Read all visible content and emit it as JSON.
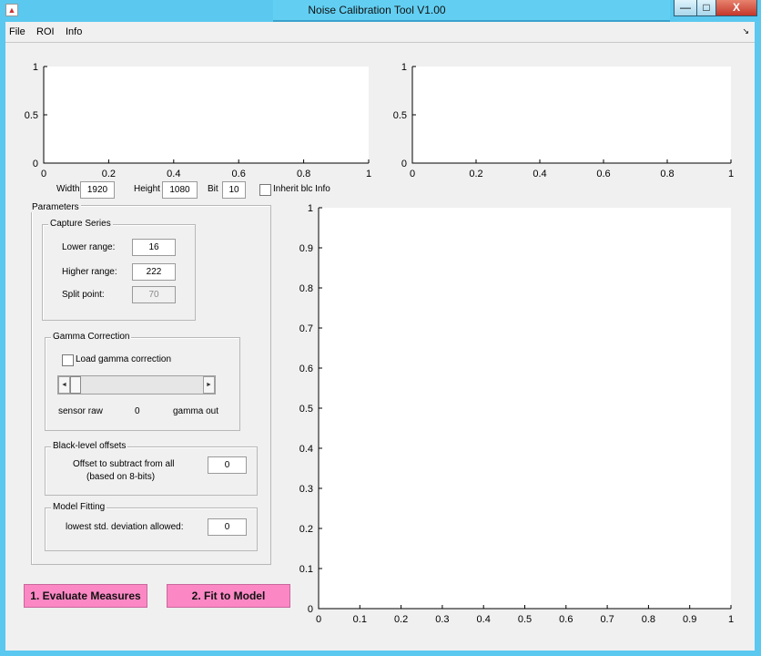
{
  "window": {
    "title": "Noise Calibration Tool V1.00",
    "min_glyph": "—",
    "max_glyph": "□",
    "close_glyph": "X",
    "app_icon_glyph": "▲"
  },
  "menu": {
    "items": [
      "File",
      "ROI",
      "Info"
    ],
    "right_glyph": "↘"
  },
  "plots": {
    "top_left": {
      "xlim": [
        0,
        1
      ],
      "ylim": [
        0,
        1
      ],
      "xticks": [
        "0",
        "0.2",
        "0.4",
        "0.6",
        "0.8",
        "1"
      ],
      "yticks": [
        "0",
        "0.5",
        "1"
      ]
    },
    "top_right": {
      "xlim": [
        0,
        1
      ],
      "ylim": [
        0,
        1
      ],
      "xticks": [
        "0",
        "0.2",
        "0.4",
        "0.6",
        "0.8",
        "1"
      ],
      "yticks": [
        "0",
        "0.5",
        "1"
      ]
    },
    "main": {
      "xlim": [
        0,
        1
      ],
      "ylim": [
        0,
        1
      ],
      "xticks": [
        "0",
        "0.1",
        "0.2",
        "0.3",
        "0.4",
        "0.5",
        "0.6",
        "0.7",
        "0.8",
        "0.9",
        "1"
      ],
      "yticks": [
        "0",
        "0.1",
        "0.2",
        "0.3",
        "0.4",
        "0.5",
        "0.6",
        "0.7",
        "0.8",
        "0.9",
        "1"
      ]
    }
  },
  "image_settings": {
    "width_label": "Width",
    "width_value": "1920",
    "height_label": "Height",
    "height_value": "1080",
    "bit_label": "Bit",
    "bit_value": "10",
    "inherit_label": "Inherit blc Info"
  },
  "parameters": {
    "title": "Parameters",
    "capture": {
      "title": "Capture Series",
      "lower_label": "Lower range:",
      "lower_value": "16",
      "higher_label": "Higher range:",
      "higher_value": "222",
      "split_label": "Split point:",
      "split_value": "70"
    },
    "gamma": {
      "title": "Gamma Correction",
      "load_label": "Load gamma correction",
      "left_label": "sensor raw",
      "slider_value": "0",
      "right_label": "gamma out",
      "slider_fraction": 0.0
    },
    "black_level": {
      "title": "Black-level offsets",
      "offset_label_1": "Offset to subtract from all",
      "offset_label_2": "(based on 8-bits)",
      "offset_value": "0"
    },
    "model": {
      "title": "Model Fitting",
      "lowest_label": "lowest std. deviation allowed:",
      "lowest_value": "0"
    }
  },
  "buttons": {
    "evaluate": "1. Evaluate Measures",
    "fit": "2. Fit to Model"
  },
  "colors": {
    "title_bar": "#5bc8ef",
    "pink_button": "#fb88c4",
    "close_button": "#c4382a"
  }
}
